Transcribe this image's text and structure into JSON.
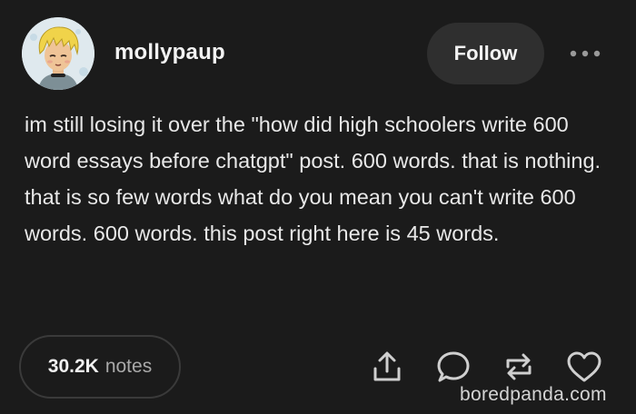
{
  "post": {
    "username": "mollypaup",
    "follow_label": "Follow",
    "body": "im still losing it over the \"how did high schoolers write 600 word essays before chatgpt\" post. 600 words. that is nothing. that is so few words what do you mean you can't write 600 words. 600 words. this post right here is 45 words.",
    "notes_count": "30.2K",
    "notes_label": "notes"
  },
  "icons": {
    "more": "ellipsis-icon",
    "share": "share-icon",
    "reply": "reply-icon",
    "reblog": "reblog-icon",
    "like": "heart-icon"
  },
  "watermark": "boredpanda.com",
  "colors": {
    "background": "#1b1b1b",
    "text": "#e8e8e8",
    "button": "#2f2f2f",
    "muted": "#a9a9a9"
  }
}
